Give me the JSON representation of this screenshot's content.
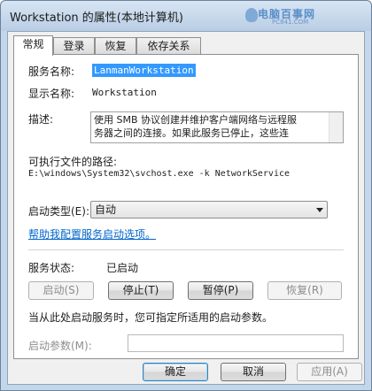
{
  "window": {
    "title": "Workstation 的属性(本地计算机)",
    "watermark_line1": "电脑百事网",
    "watermark_line2": "PC841.COM"
  },
  "tabs": [
    {
      "label": "常规",
      "active": true
    },
    {
      "label": "登录",
      "active": false
    },
    {
      "label": "恢复",
      "active": false
    },
    {
      "label": "依存关系",
      "active": false
    }
  ],
  "general": {
    "service_name_label": "服务名称:",
    "service_name_value": "LanmanWorkstation",
    "display_name_label": "显示名称:",
    "display_name_value": "Workstation",
    "description_label": "描述:",
    "description_line1": "使用 SMB 协议创建并维护客户端网络与远程服",
    "description_line2": "务器之间的连接。如果此服务已停止，这些连",
    "path_label": "可执行文件的路径:",
    "path_value": "E:\\windows\\System32\\svchost.exe -k NetworkService",
    "startup_type_label": "启动类型(E):",
    "startup_type_value": "自动",
    "help_link": "帮助我配置服务启动选项。",
    "status_label": "服务状态:",
    "status_value": "已启动",
    "start_button": "启动(S)",
    "stop_button": "停止(T)",
    "pause_button": "暂停(P)",
    "resume_button": "恢复(R)",
    "hint_text": "当从此处启动服务时，您可指定所适用的启动参数。",
    "start_params_label": "启动参数(M):",
    "start_params_value": ""
  },
  "footer": {
    "ok_button": "确定",
    "cancel_button": "取消",
    "apply_button": "应用(A)"
  }
}
